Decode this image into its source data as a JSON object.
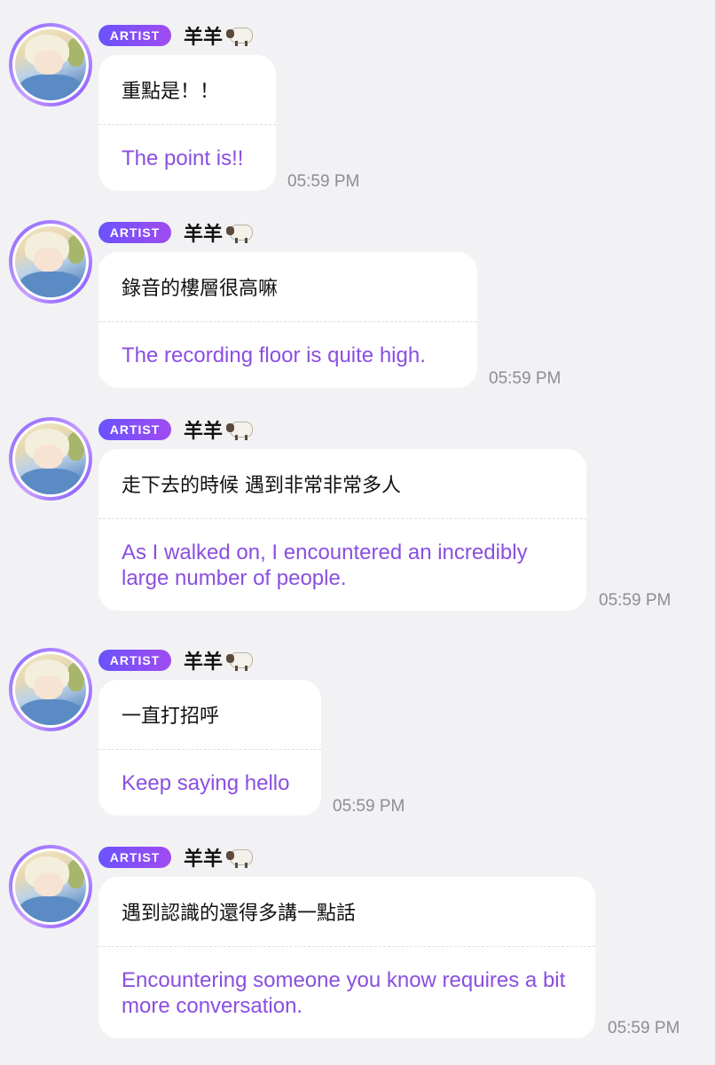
{
  "messages": [
    {
      "badge": "ARTIST",
      "name": "羊羊",
      "name_icon": "sheep-icon",
      "original": "重點是！！",
      "translation": "The point is!!",
      "time": "05:59 PM"
    },
    {
      "badge": "ARTIST",
      "name": "羊羊",
      "name_icon": "sheep-icon",
      "original": "錄音的樓層很高嘛",
      "translation": "The recording floor is quite high.",
      "time": "05:59 PM"
    },
    {
      "badge": "ARTIST",
      "name": "羊羊",
      "name_icon": "sheep-icon",
      "original": "走下去的時候 遇到非常非常多人",
      "translation": "As I walked on, I encountered an incredibly large number of people.",
      "time": "05:59 PM"
    },
    {
      "badge": "ARTIST",
      "name": "羊羊",
      "name_icon": "sheep-icon",
      "original": "一直打招呼",
      "translation": "Keep saying hello",
      "time": "05:59 PM"
    },
    {
      "badge": "ARTIST",
      "name": "羊羊",
      "name_icon": "sheep-icon",
      "original": "遇到認識的還得多講一點話",
      "translation": "Encountering someone you know requires a bit more conversation.",
      "time": "05:59 PM"
    }
  ],
  "colors": {
    "background": "#f2f2f4",
    "badge_gradient_start": "#6a52ff",
    "badge_gradient_end": "#a04cf0",
    "translation_text": "#8a4fe0",
    "timestamp_text": "#8e8e93"
  }
}
